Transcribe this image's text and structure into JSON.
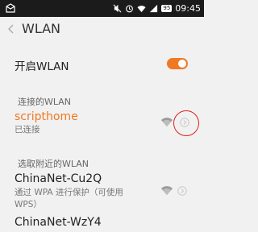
{
  "status_bar": {
    "time": "09:45",
    "battery": "95"
  },
  "header": {
    "title": "WLAN"
  },
  "toggle": {
    "label": "开启WLAN",
    "on": true
  },
  "connected_section": {
    "label": "连接的WLAN",
    "network": {
      "name": "scripthome",
      "status": "已连接"
    }
  },
  "nearby_section": {
    "label": "选取附近的WLAN",
    "networks": [
      {
        "name": "ChinaNet-Cu2Q",
        "detail": "通过 WPA 进行保护（可使用 WPS）"
      },
      {
        "name": "ChinaNet-WzY4"
      }
    ]
  },
  "colors": {
    "accent": "#f07a22",
    "annotation": "#e02020"
  }
}
